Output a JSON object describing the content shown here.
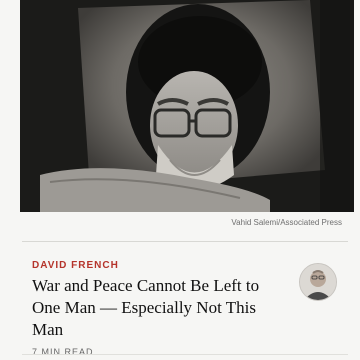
{
  "photo": {
    "credit": "Vahid Salemi/Associated Press"
  },
  "article": {
    "author": "DAVID FRENCH",
    "headline": "War and Peace Cannot Be Left to One Man — Especially Not This Man",
    "read_time": "7 MIN READ"
  },
  "colors": {
    "author_accent": "#b5342b",
    "headline": "#111111",
    "meta": "#666666",
    "background": "#f6f6f4"
  }
}
